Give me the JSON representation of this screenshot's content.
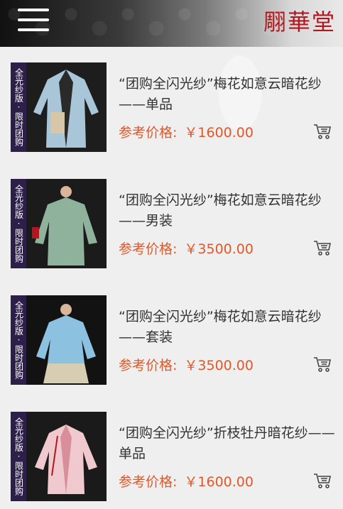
{
  "header": {
    "brand": "翢華堂",
    "menu_icon": "hamburger-menu-icon"
  },
  "products": [
    {
      "badge": "全光纱版·限时团购",
      "title": "“团购全闪光纱”梅花如意云暗花纱——单品",
      "price_label": "参考价格:",
      "price": "￥1600.00",
      "cart_icon": "cart-icon",
      "garment_color": "#a8c6d8"
    },
    {
      "badge": "全光纱版·限时团购",
      "title": "“团购全闪光纱”梅花如意云暗花纱——男装",
      "price_label": "参考价格:",
      "price": "￥3500.00",
      "cart_icon": "cart-icon",
      "garment_color": "#8fb29d"
    },
    {
      "badge": "全光纱版·限时团购",
      "title": "“团购全闪光纱”梅花如意云暗花纱——套装",
      "price_label": "参考价格:",
      "price": "￥3500.00",
      "cart_icon": "cart-icon",
      "garment_color": "#8cc1e0"
    },
    {
      "badge": "全光纱版·限时团购",
      "title": "“团购全闪光纱”折枝牡丹暗花纱——单品",
      "price_label": "参考价格:",
      "price": "￥1600.00",
      "cart_icon": "cart-icon",
      "garment_color": "#f0c9cf"
    }
  ]
}
